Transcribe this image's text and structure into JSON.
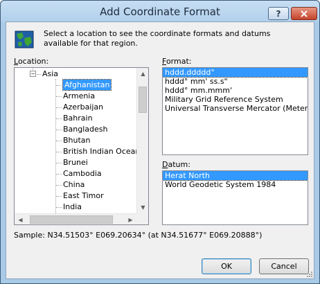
{
  "window": {
    "title": "Add Coordinate Format",
    "help_label": "?",
    "close_label": "X"
  },
  "intro_text": "Select a location to see the coordinate formats and datums available for that region.",
  "location": {
    "label_key": "L",
    "label_rest": "ocation:",
    "parent": "Asia",
    "items": [
      "Afghanistan",
      "Armenia",
      "Azerbaijan",
      "Bahrain",
      "Bangladesh",
      "Bhutan",
      "British Indian Ocean Ter",
      "Brunei",
      "Cambodia",
      "China",
      "East Timor",
      "India"
    ],
    "selected": "Afghanistan"
  },
  "format": {
    "label_key": "F",
    "label_rest": "ormat:",
    "items": [
      "hddd.ddddd°",
      "hddd° mm' ss.s\"",
      "hddd° mm.mmm'",
      "Military Grid Reference System",
      "Universal Transverse Mercator (Meters)"
    ],
    "selected": "hddd.ddddd°"
  },
  "datum": {
    "label_key": "D",
    "label_rest": "atum:",
    "items": [
      "Herat North",
      "World Geodetic System 1984"
    ],
    "selected": "Herat North"
  },
  "sample_text": "Sample: N34.51503°  E069.20634° (at N34.51677°  E069.20888°)",
  "buttons": {
    "ok": "OK",
    "cancel": "Cancel"
  },
  "colors": {
    "selection": "#3399ff",
    "frame": "#a9cbe8",
    "close_button": "#c4442a"
  },
  "icons": {
    "app": "globe-map-icon",
    "expander": "minus-box-icon"
  }
}
